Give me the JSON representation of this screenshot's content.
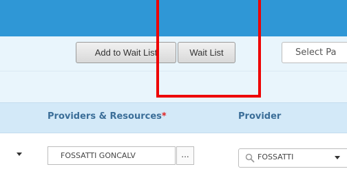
{
  "toolbar": {
    "add_to_wait_list_label": "Add to Wait List",
    "wait_list_label": "Wait List",
    "select_patient_text": "Select Pa"
  },
  "table": {
    "headers": {
      "providers_resources": "Providers & Resources",
      "required_marker": "*",
      "provider": "Provider"
    },
    "row": {
      "resource_value": "FOSSATTI GONCALV",
      "ellipsis_label": "...",
      "provider_value": "FOSSATTI"
    }
  },
  "colors": {
    "top_bar": "#2f97d6",
    "header_text": "#3b6e98",
    "highlight": "#ee0000"
  },
  "icons": [
    "search-icon",
    "caret-down-icon"
  ]
}
